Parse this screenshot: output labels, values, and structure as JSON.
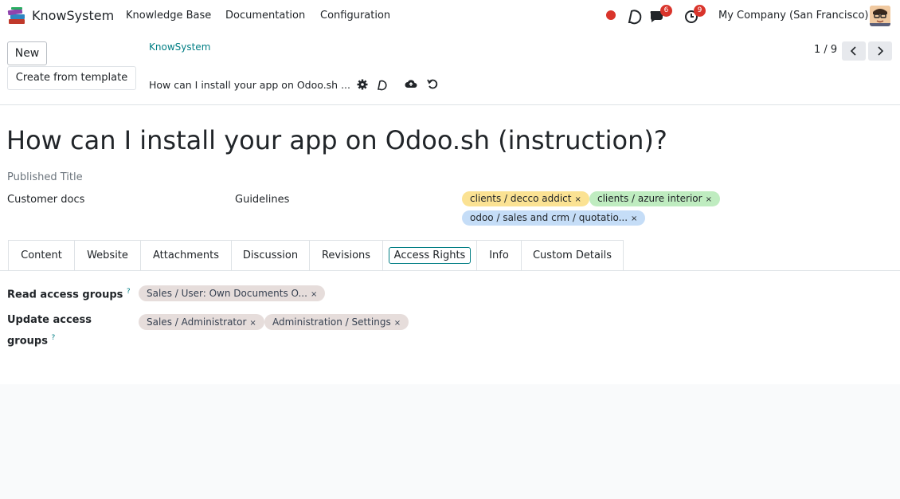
{
  "navbar": {
    "app_name": "KnowSystem",
    "menus": [
      "Knowledge Base",
      "Documentation",
      "Configuration"
    ],
    "messages_badge": "6",
    "activities_badge": "9",
    "company": "My Company (San Francisco)"
  },
  "control": {
    "new_label": "New",
    "template_label": "Create from template",
    "breadcrumb": "KnowSystem",
    "record_title": "How can I install your app on Odoo.sh ...",
    "pager": "1 / 9"
  },
  "form": {
    "title": "How can I install your app on Odoo.sh (instruction)?",
    "published_title_label": "Published Title",
    "section": "Customer docs",
    "tag_label": "Guidelines",
    "tags": [
      {
        "label": "clients / decco addict",
        "color": "#fbe293"
      },
      {
        "label": "clients / azure interior",
        "color": "#bfecc0"
      },
      {
        "label": "odoo / sales and crm / quotatio...",
        "color": "#c5ddf7"
      }
    ]
  },
  "tabs": [
    "Content",
    "Website",
    "Attachments",
    "Discussion",
    "Revisions",
    "Access Rights",
    "Info",
    "Custom Details"
  ],
  "active_tab": "Access Rights",
  "access": {
    "read_label": "Read access groups",
    "read_groups": [
      "Sales / User: Own Documents O..."
    ],
    "update_label_1": "Update access",
    "update_label_2": "groups",
    "update_groups": [
      "Sales / Administrator",
      "Administration / Settings"
    ],
    "help": "?"
  },
  "remove_glyph": "×",
  "colors": {
    "accent": "#017e84",
    "badge": "#d9342b",
    "group_tag": "#e6dddb"
  }
}
